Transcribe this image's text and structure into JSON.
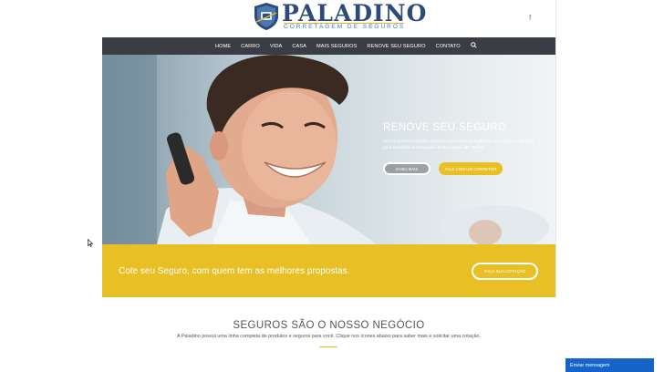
{
  "header": {
    "brand_name": "PALADINO",
    "brand_sub": "CORRETAGEM DE SEGUROS",
    "social_icon": "facebook-icon",
    "social_label": "f"
  },
  "nav": {
    "items": [
      "HOME",
      "CARRO",
      "VIDA",
      "CASA",
      "MAIS SEGUROS",
      "RENOVE SEU SEGURO",
      "CONTATO"
    ],
    "search_icon": "search-icon"
  },
  "hero": {
    "title": "RENOVE SEU SEGURO",
    "text": "Uma seguradora propõe a melhor, Conhecemos melhores companhias com mais para beneficiar e renovação do seu seguro até 30 dias.",
    "button_outline": "SAIBA MAIS",
    "button_yellow": "FALE COM UM CORRETOR"
  },
  "band": {
    "text": "Cote seu Seguro, com quem tem as melhores propostas.",
    "button": "FAÇA SUA COTAÇÃO"
  },
  "section": {
    "title": "SEGUROS SÃO O NOSSO NEGÓCIO",
    "text": "A Paladino possui uma linha completa de produtos e seguros para você. Clique nos ícones abaixo para saber mais e solicitar uma cotação."
  },
  "chat": {
    "label": "Enviar mensagem"
  },
  "colors": {
    "nav_bg": "#3a3d43",
    "accent_yellow": "#e8bf25",
    "brand_blue": "#2d4b7a",
    "chat_blue": "#1565c8"
  }
}
